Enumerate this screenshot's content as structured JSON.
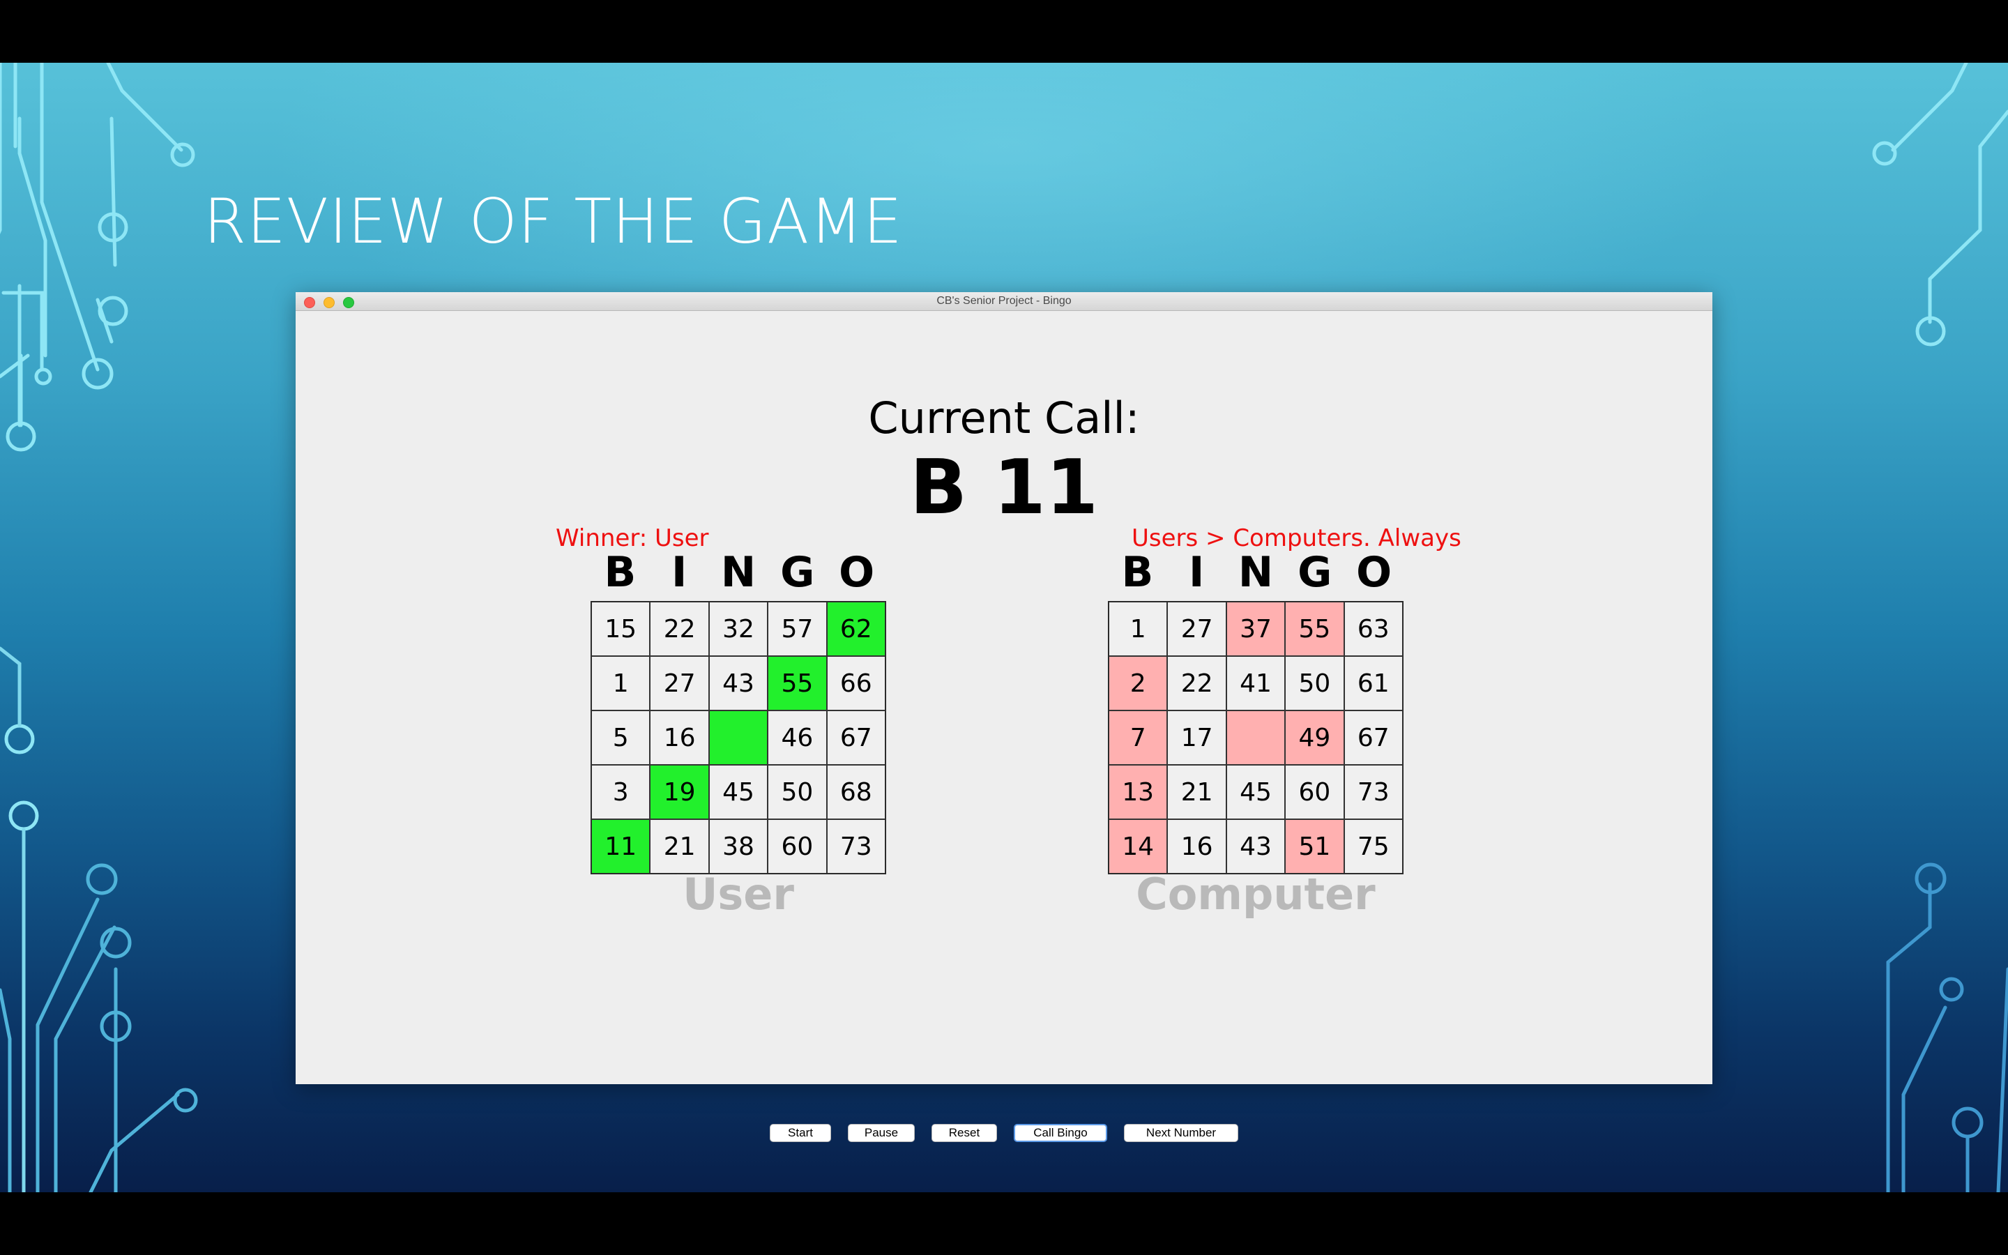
{
  "slide": {
    "title": "REVIEW OF THE GAME"
  },
  "window": {
    "title": "CB's Senior Project - Bingo"
  },
  "current_call": {
    "label": "Current Call:",
    "value": "B 11"
  },
  "user_board": {
    "status": "Winner: User",
    "headers": [
      "B",
      "I",
      "N",
      "G",
      "O"
    ],
    "owner": "User",
    "highlight_color": "#22f02c",
    "rows": [
      [
        {
          "v": "15",
          "hit": false
        },
        {
          "v": "22",
          "hit": false
        },
        {
          "v": "32",
          "hit": false
        },
        {
          "v": "57",
          "hit": false
        },
        {
          "v": "62",
          "hit": true
        }
      ],
      [
        {
          "v": "1",
          "hit": false
        },
        {
          "v": "27",
          "hit": false
        },
        {
          "v": "43",
          "hit": false
        },
        {
          "v": "55",
          "hit": true
        },
        {
          "v": "66",
          "hit": false
        }
      ],
      [
        {
          "v": "5",
          "hit": false
        },
        {
          "v": "16",
          "hit": false
        },
        {
          "v": "",
          "hit": true
        },
        {
          "v": "46",
          "hit": false
        },
        {
          "v": "67",
          "hit": false
        }
      ],
      [
        {
          "v": "3",
          "hit": false
        },
        {
          "v": "19",
          "hit": true
        },
        {
          "v": "45",
          "hit": false
        },
        {
          "v": "50",
          "hit": false
        },
        {
          "v": "68",
          "hit": false
        }
      ],
      [
        {
          "v": "11",
          "hit": true
        },
        {
          "v": "21",
          "hit": false
        },
        {
          "v": "38",
          "hit": false
        },
        {
          "v": "60",
          "hit": false
        },
        {
          "v": "73",
          "hit": false
        }
      ]
    ]
  },
  "computer_board": {
    "status": "Users > Computers. Always",
    "headers": [
      "B",
      "I",
      "N",
      "G",
      "O"
    ],
    "owner": "Computer",
    "highlight_color": "#ffb0b0",
    "rows": [
      [
        {
          "v": "1",
          "hit": false
        },
        {
          "v": "27",
          "hit": false
        },
        {
          "v": "37",
          "hit": true
        },
        {
          "v": "55",
          "hit": true
        },
        {
          "v": "63",
          "hit": false
        }
      ],
      [
        {
          "v": "2",
          "hit": true
        },
        {
          "v": "22",
          "hit": false
        },
        {
          "v": "41",
          "hit": false
        },
        {
          "v": "50",
          "hit": false
        },
        {
          "v": "61",
          "hit": false
        }
      ],
      [
        {
          "v": "7",
          "hit": true
        },
        {
          "v": "17",
          "hit": false
        },
        {
          "v": "",
          "hit": true
        },
        {
          "v": "49",
          "hit": true
        },
        {
          "v": "67",
          "hit": false
        }
      ],
      [
        {
          "v": "13",
          "hit": true
        },
        {
          "v": "21",
          "hit": false
        },
        {
          "v": "45",
          "hit": false
        },
        {
          "v": "60",
          "hit": false
        },
        {
          "v": "73",
          "hit": false
        }
      ],
      [
        {
          "v": "14",
          "hit": true
        },
        {
          "v": "16",
          "hit": false
        },
        {
          "v": "43",
          "hit": false
        },
        {
          "v": "51",
          "hit": true
        },
        {
          "v": "75",
          "hit": false
        }
      ]
    ]
  },
  "buttons": {
    "start": "Start",
    "pause": "Pause",
    "reset": "Reset",
    "call_bingo": "Call Bingo",
    "next_number": "Next Number"
  }
}
